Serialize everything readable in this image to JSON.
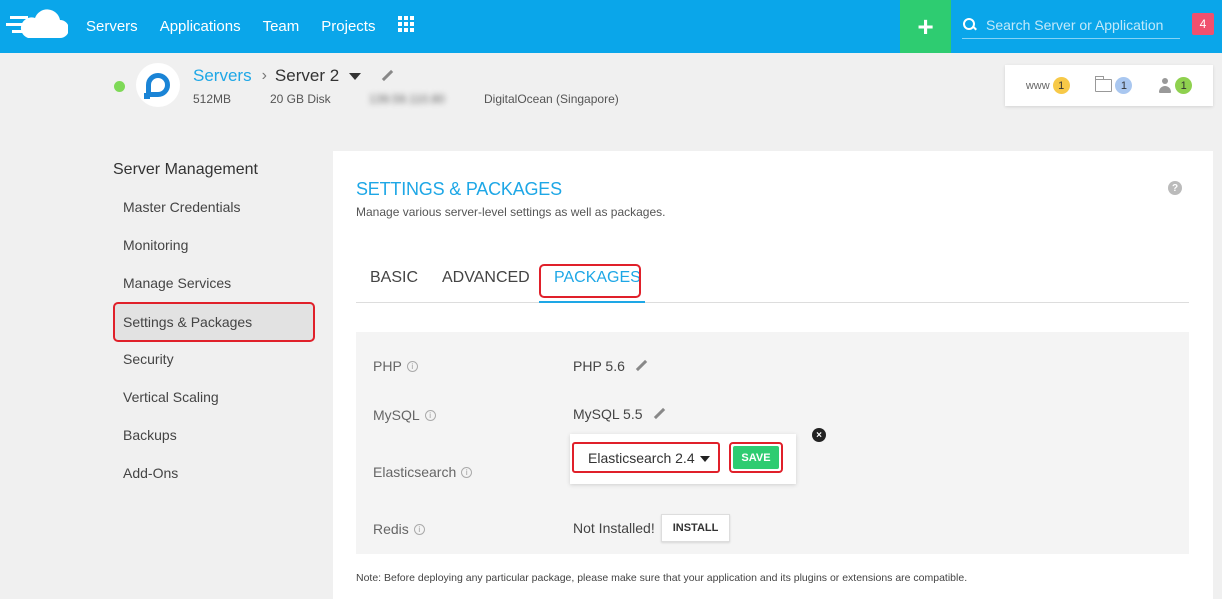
{
  "topnav": {
    "items": [
      "Servers",
      "Applications",
      "Team",
      "Projects"
    ],
    "search_placeholder": "Search Server or Application",
    "notification_count": "4",
    "add_label": "+"
  },
  "server": {
    "breadcrumb_parent": "Servers",
    "name": "Server 2",
    "ram": "512MB",
    "disk": "20 GB Disk",
    "ip": "139.59.110.80",
    "provider": "DigitalOcean (Singapore)"
  },
  "stats": {
    "www_label": "www",
    "www_count": "1",
    "folder_count": "1",
    "user_count": "1"
  },
  "sidebar": {
    "title": "Server Management",
    "items": [
      {
        "label": "Master Credentials"
      },
      {
        "label": "Monitoring"
      },
      {
        "label": "Manage Services"
      },
      {
        "label": "Settings & Packages"
      },
      {
        "label": "Security"
      },
      {
        "label": "Vertical Scaling"
      },
      {
        "label": "Backups"
      },
      {
        "label": "Add-Ons"
      }
    ]
  },
  "main": {
    "title": "SETTINGS & PACKAGES",
    "subtitle": "Manage various server-level settings as well as packages.",
    "help": "?",
    "tabs": [
      {
        "label": "BASIC"
      },
      {
        "label": "ADVANCED"
      },
      {
        "label": "PACKAGES"
      }
    ],
    "packages": {
      "php_label": "PHP",
      "php_value": "PHP 5.6",
      "mysql_label": "MySQL",
      "mysql_value": "MySQL 5.5",
      "es_label": "Elasticsearch",
      "es_selected": "Elasticsearch 2.4",
      "save_label": "SAVE",
      "redis_label": "Redis",
      "redis_value": "Not Installed!",
      "install_label": "INSTALL"
    },
    "note": "Note: Before deploying any particular package, please make sure that your application and its plugins or extensions are compatible."
  }
}
